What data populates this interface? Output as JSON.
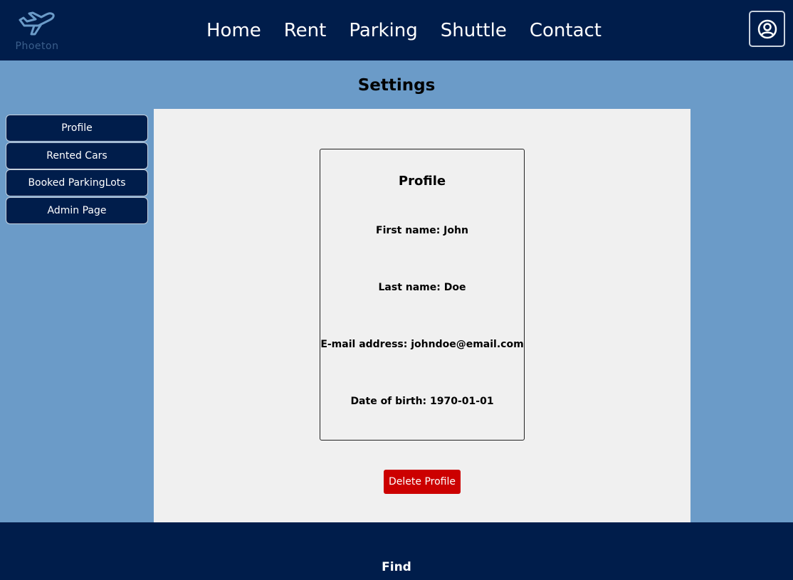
{
  "brand": {
    "name": "Phoeton",
    "accent": "#6b9bc8",
    "navbar_color": "#001d4b"
  },
  "nav": {
    "links": [
      {
        "label": "Home"
      },
      {
        "label": "Rent"
      },
      {
        "label": "Parking"
      },
      {
        "label": "Shuttle"
      },
      {
        "label": "Contact"
      }
    ],
    "user_icon": "user-circle-icon"
  },
  "page": {
    "title": "Settings"
  },
  "sidebar": {
    "items": [
      {
        "label": "Profile"
      },
      {
        "label": "Rented Cars"
      },
      {
        "label": "Booked ParkingLots"
      },
      {
        "label": "Admin Page"
      }
    ]
  },
  "profile": {
    "title": "Profile",
    "first_name": "First name: John",
    "last_name": "Last name: Doe",
    "email": "E-mail address: johndoe@email.com",
    "dob": "Date of birth: 1970-01-01"
  },
  "actions": {
    "delete_label": "Delete Profile",
    "delete_color": "#cc0000"
  },
  "footer": {
    "text": "Find"
  }
}
